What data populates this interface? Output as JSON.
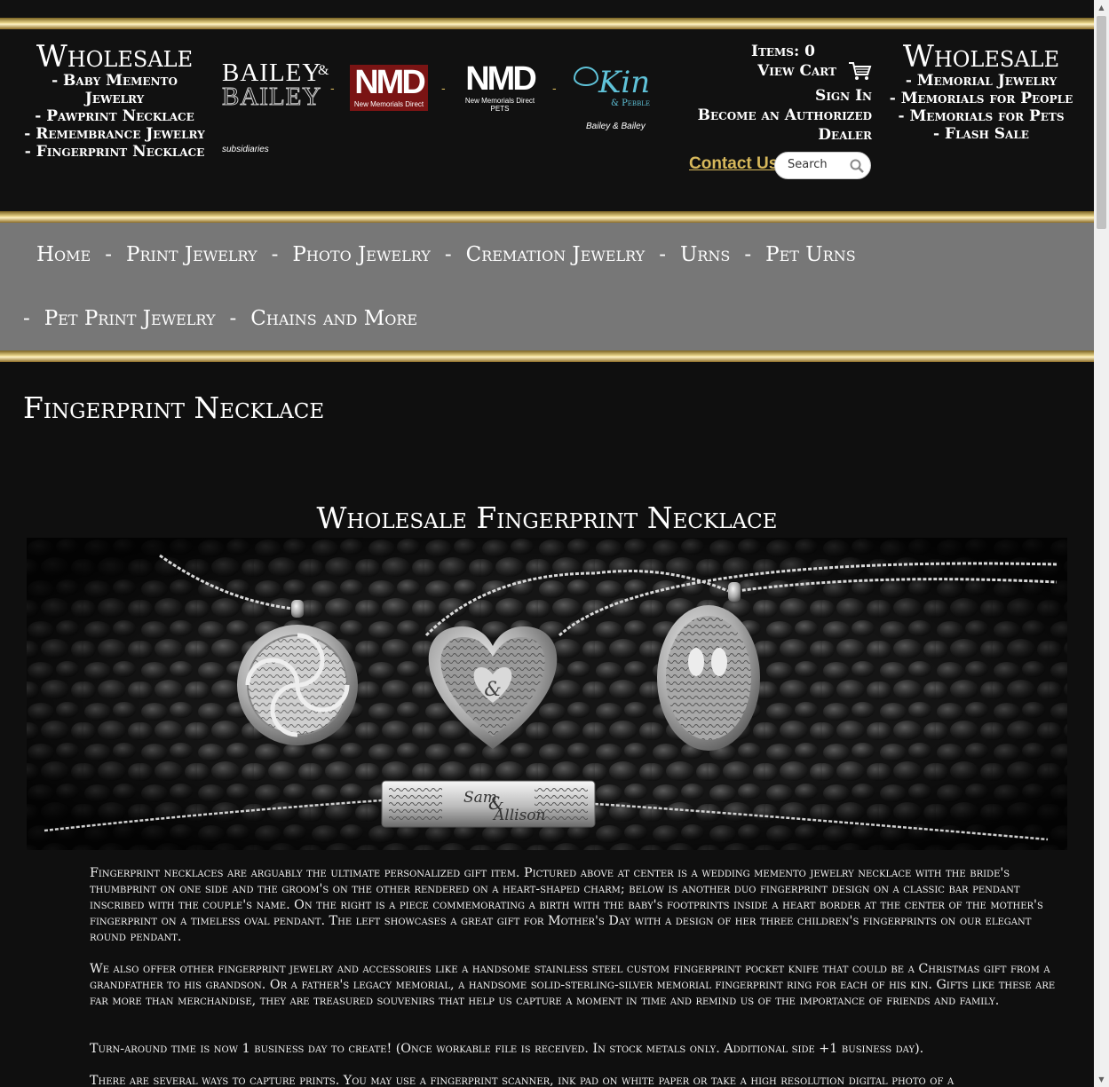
{
  "header": {
    "left": {
      "title": "Wholesale",
      "links": [
        "- Baby Memento Jewelry",
        "- Pawprint Necklace",
        "- Remembrance Jewelry",
        "- Fingerprint Necklace"
      ]
    },
    "right": {
      "title": "Wholesale",
      "links": [
        "- Memorial Jewelry",
        "- Memorials for People",
        "- Memorials for Pets",
        "- Flash Sale"
      ]
    },
    "logos": {
      "bailey_line1": "BAILEY",
      "bailey_amp": "&",
      "bailey_line2": "BAILEY",
      "subsidiaries": "subsidiaries",
      "nmd_big": "NMD",
      "nmd_small": "New Memorials Direct",
      "nmd_pets_big": "NMD",
      "nmd_pets_small1": "New Memorials Direct",
      "nmd_pets_small2": "PETS",
      "kin": "Kin",
      "pebble": "& Pebble",
      "caption": "Bailey & Bailey",
      "separator": "-"
    },
    "account": {
      "items": "Items: 0",
      "view_cart": "View Cart",
      "sign_in": "Sign In",
      "become_dealer": "Become an Authorized Dealer",
      "contact": "Contact Us",
      "search_placeholder": "Search"
    }
  },
  "nav": {
    "row1": [
      "Home",
      "Print Jewelry",
      "Photo Jewelry",
      "Cremation Jewelry",
      "Urns",
      "Pet Urns"
    ],
    "row2": [
      "Pet Print Jewelry",
      "Chains and More"
    ],
    "separator": "-"
  },
  "main": {
    "page_title": "Fingerprint Necklace",
    "sub_title": "Wholesale Fingerprint Necklace",
    "hero_engraving_1": "Sam",
    "hero_engraving_amp": "&",
    "hero_engraving_2": "Allison",
    "hero_heart_amp": "&",
    "paragraphs": [
      "Fingerprint necklaces are arguably the ultimate personalized gift item. Pictured above at center is a wedding memento jewelry necklace with the bride's thumbprint on one side and the groom's on the other rendered on a heart-shaped charm; below is another duo fingerprint design on a classic bar pendant inscribed with the couple's name. On the right is a piece commemorating a birth with the baby's footprints inside a heart border at the center of the mother's fingerprint on a timeless oval pendant. The left showcases a great gift for Mother's Day with a design of her three children's fingerprints on our elegant round pendant.",
      "We also offer other fingerprint jewelry and accessories like a handsome stainless steel custom fingerprint pocket knife that could be a Christmas gift from a grandfather to his grandson. Or a father's legacy memorial, a handsome solid-sterling-silver memorial fingerprint ring for each of his kin. Gifts like these are far more than merchandise, they are treasured souvenirs that help us capture a moment in time and remind us of the importance of friends and family.",
      "Turn-around time is now 1 business day to create! (Once workable file is received. In stock metals only. Additional side +1 business day).",
      "There are several ways to capture prints. You may use a fingerprint scanner, ink pad on white paper or take a high resolution digital photo of a"
    ]
  },
  "colors": {
    "gold": "#d7b85b",
    "nav_bg": "#777777",
    "page_bg": "#0f0f0f",
    "nmd_red": "#7a1414",
    "kin_blue": "#5fc2d8"
  },
  "icons": [
    "cart-icon",
    "search-icon"
  ]
}
